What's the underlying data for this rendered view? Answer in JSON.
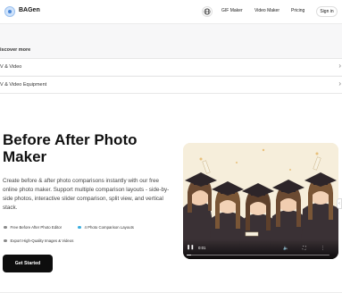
{
  "header": {
    "brand": "BAGen",
    "nav": [
      "GIF Maker",
      "Video Maker",
      "Pricing"
    ],
    "signin_label": "Sign in"
  },
  "discover": {
    "title": "iscover more",
    "items": [
      {
        "label": "V & Video"
      },
      {
        "label": "V & Video Equipment"
      }
    ]
  },
  "hero": {
    "title": "Before After Photo Maker",
    "description": "Create before & after photo comparisons instantly with our free online photo maker. Support multiple comparison layouts - side-by-side photos, interactive slider comparison, split view, and vertical stack.",
    "features": [
      {
        "label": "Free Before After Photo Editor",
        "color": "#8a8a8a"
      },
      {
        "label": "4 Photo Comparison Layouts",
        "color": "#3aaee0"
      },
      {
        "label": "Export High-Quality Images & Videos",
        "color": "#8a8a8a"
      }
    ],
    "cta_label": "Get Started"
  },
  "video": {
    "time": "0:01",
    "progress": 0.03,
    "icons": [
      "play-icon",
      "volume-icon",
      "fullscreen-icon",
      "more-icon"
    ]
  }
}
